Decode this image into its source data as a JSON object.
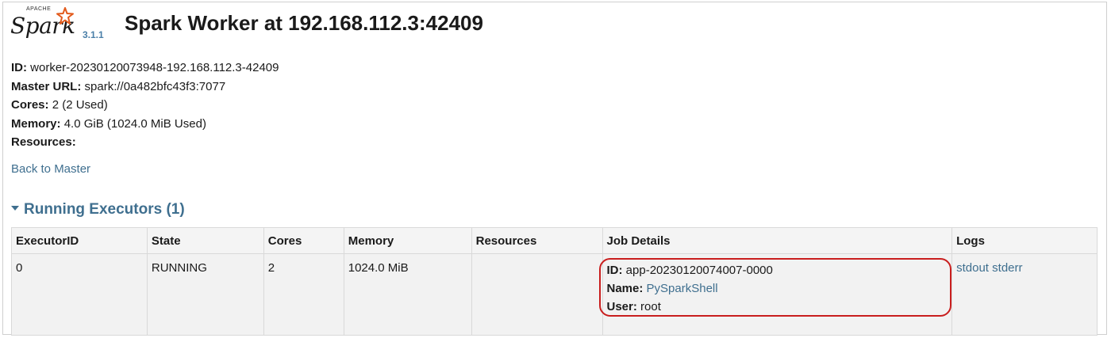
{
  "logo": {
    "apache": "APACHE",
    "spark": "Spark",
    "version": "3.1.1"
  },
  "page_title": "Spark Worker at 192.168.112.3:42409",
  "info": [
    {
      "label": "ID:",
      "value": "worker-20230120073948-192.168.112.3-42409"
    },
    {
      "label": "Master URL:",
      "value": "spark://0a482bfc43f3:7077"
    },
    {
      "label": "Cores:",
      "value": "2 (2 Used)"
    },
    {
      "label": "Memory:",
      "value": "4.0 GiB (1024.0 MiB Used)"
    },
    {
      "label": "Resources:",
      "value": ""
    }
  ],
  "back_link": "Back to Master",
  "section_title": "Running Executors (1)",
  "table": {
    "headers": [
      "ExecutorID",
      "State",
      "Cores",
      "Memory",
      "Resources",
      "Job Details",
      "Logs"
    ],
    "rows": [
      {
        "executor_id": "0",
        "state": "RUNNING",
        "cores": "2",
        "memory": "1024.0 MiB",
        "resources": "",
        "job": {
          "id_label": "ID:",
          "id_value": "app-20230120074007-0000",
          "name_label": "Name:",
          "name_value": "PySparkShell",
          "user_label": "User:",
          "user_value": "root"
        },
        "logs": {
          "stdout": "stdout",
          "stderr": "stderr"
        }
      }
    ]
  },
  "colors": {
    "link": "#3f6f8f",
    "highlight": "#c91e1e",
    "version": "#4a7fa8"
  }
}
